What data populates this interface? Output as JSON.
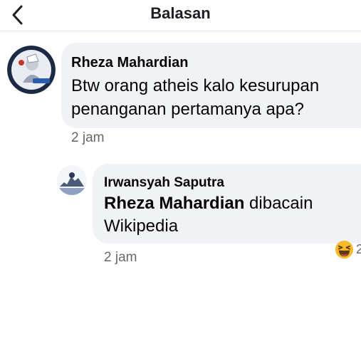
{
  "header": {
    "title": "Balasan",
    "back_icon": "chevron-left-icon"
  },
  "comment": {
    "author": "Rheza Mahardian",
    "text": "Btw orang atheis kalo kesurupan penanganan pertamanya apa?",
    "time": "2 jam"
  },
  "reply": {
    "author": "Irwansyah Saputra",
    "mention": "Rheza Mahardian",
    "text": " dibacain Wikipedia",
    "time": "2 jam",
    "reaction": {
      "icon": "haha-emoji-icon",
      "count": "2"
    }
  },
  "colors": {
    "bubble": "#f0f2f5",
    "meta": "#65676b",
    "text": "#050505",
    "reaction": "#f7b928"
  }
}
